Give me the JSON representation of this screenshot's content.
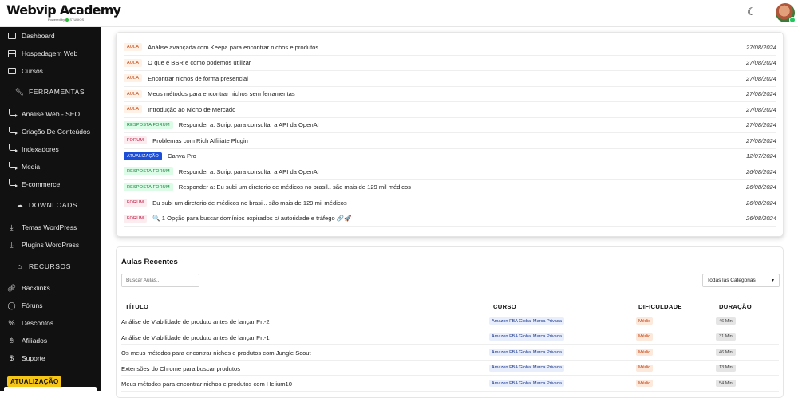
{
  "header": {
    "logo_text": "Webvip Academy",
    "logo_sub": "Powered by",
    "logo_sub_brand": "STUDIOS",
    "theme_icon": "moon-icon",
    "avatar_icon": "user-avatar"
  },
  "sidebar": {
    "items": [
      {
        "label": "Dashboard",
        "icon": "monitor-icon"
      },
      {
        "label": "Hospedagem Web",
        "icon": "server-icon"
      },
      {
        "label": "Cursos",
        "icon": "monitor-icon"
      },
      {
        "label": "FERRAMENTAS",
        "icon": "wrench-icon",
        "section": true
      },
      {
        "label": "Análise Web - SEO",
        "icon": "arrow-corner-icon"
      },
      {
        "label": "Criação De Conteúdos",
        "icon": "arrow-corner-icon"
      },
      {
        "label": "Indexadores",
        "icon": "arrow-corner-icon"
      },
      {
        "label": "Media",
        "icon": "arrow-corner-icon"
      },
      {
        "label": "E-commerce",
        "icon": "arrow-corner-icon"
      },
      {
        "label": "DOWNLOADS",
        "icon": "cloud-download-icon",
        "section": true
      },
      {
        "label": "Temas WordPress",
        "icon": "download-icon"
      },
      {
        "label": "Plugins WordPress",
        "icon": "download-icon"
      },
      {
        "label": "RECURSOS",
        "icon": "building-icon",
        "section": true
      },
      {
        "label": "Backlinks",
        "icon": "link-icon"
      },
      {
        "label": "Fóruns",
        "icon": "chat-icon"
      },
      {
        "label": "Descontos",
        "icon": "percent-icon"
      },
      {
        "label": "Afiliados",
        "icon": "handshake-icon"
      },
      {
        "label": "Suporte",
        "icon": "dollar-icon"
      }
    ],
    "update_badge": "ATUALIZAÇÃO"
  },
  "feed": {
    "rows": [
      {
        "tag": "AULA",
        "type": "aula",
        "title": "Análise avançada com Keepa para encontrar nichos e produtos",
        "date": "27/08/2024"
      },
      {
        "tag": "AULA",
        "type": "aula",
        "title": "O que é BSR e como podemos utilizar",
        "date": "27/08/2024"
      },
      {
        "tag": "AULA",
        "type": "aula",
        "title": "Encontrar nichos de forma presencial",
        "date": "27/08/2024"
      },
      {
        "tag": "AULA",
        "type": "aula",
        "title": "Meus métodos para encontrar nichos sem ferramentas",
        "date": "27/08/2024"
      },
      {
        "tag": "AULA",
        "type": "aula",
        "title": "Introdução ao Nicho de Mercado",
        "date": "27/08/2024"
      },
      {
        "tag": "RESPOSTA FORUM",
        "type": "resposta",
        "title": "Responder a: Script para consultar a API da OpenAI",
        "date": "27/08/2024"
      },
      {
        "tag": "FORUM",
        "type": "forum",
        "title": "Problemas com Rich Affiliate Plugin",
        "date": "27/08/2024"
      },
      {
        "tag": "ATUALIZAÇÃO",
        "type": "atual",
        "title": "Canva Pro",
        "date": "12/07/2024"
      },
      {
        "tag": "RESPOSTA FORUM",
        "type": "resposta",
        "title": "Responder a: Script para consultar a API da OpenAI",
        "date": "26/08/2024"
      },
      {
        "tag": "RESPOSTA FORUM",
        "type": "resposta",
        "title": "Responder a: Eu subi um diretorio de médicos no brasil.. são mais de 129 mil médicos",
        "date": "26/08/2024"
      },
      {
        "tag": "FORUM",
        "type": "forum",
        "title": "Eu subi um diretorio de médicos no brasil.. são mais de 129 mil médicos",
        "date": "26/08/2024"
      },
      {
        "tag": "FORUM",
        "type": "forum",
        "title": "🔍 1 Opção para buscar domínios expirados c/ autoridade e tráfego 🔗🚀",
        "date": "26/08/2024"
      }
    ]
  },
  "recent": {
    "title": "Aulas Recentes",
    "search_placeholder": "Buscar Aulas...",
    "category_select": "Todas las Categorias",
    "columns": [
      "TÍTULO",
      "CURSO",
      "DIFICULDADE",
      "DURAÇÃO"
    ],
    "rows": [
      {
        "title": "Análise de Viabilidade de produto antes de lançar Prt-2",
        "course": "Amazon FBA Global Marca Privada",
        "difficulty": "Médio",
        "duration": "46 Min"
      },
      {
        "title": "Análise de Viabilidade de produto antes de lançar Prt-1",
        "course": "Amazon FBA Global Marca Privada",
        "difficulty": "Médio",
        "duration": "31 Min"
      },
      {
        "title": "Os meus métodos para encontrar nichos e produtos com Jungle Scout",
        "course": "Amazon FBA Global Marca Privada",
        "difficulty": "Médio",
        "duration": "46 Min"
      },
      {
        "title": "Extensões do Chrome para buscar produtos",
        "course": "Amazon FBA Global Marca Privada",
        "difficulty": "Médio",
        "duration": "13 Min"
      },
      {
        "title": "Meus métodos para encontrar nichos e produtos com Helium10",
        "course": "Amazon FBA Global Marca Privada",
        "difficulty": "Médio",
        "duration": "54 Min"
      }
    ]
  }
}
